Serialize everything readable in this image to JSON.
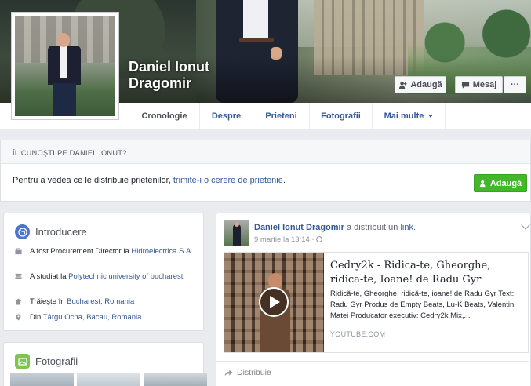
{
  "profile": {
    "name_line1": "Daniel Ionut",
    "name_line2": "Dragomir"
  },
  "cover_buttons": {
    "add_label": "Adaugă",
    "message_label": "Mesaj",
    "more_label": "···"
  },
  "nav": {
    "tabs": [
      {
        "label": "Cronologie",
        "active": true
      },
      {
        "label": "Despre"
      },
      {
        "label": "Prieteni"
      },
      {
        "label": "Fotografii"
      },
      {
        "label": "Mai multe"
      }
    ]
  },
  "friend_request": {
    "heading": "ÎL CUNOŞTI PE DANIEL IONUT?",
    "text_prefix": "Pentru a vedea ce le distribuie prietenilor, ",
    "text_link": "trimite-i o cerere de prietenie",
    "text_suffix": ".",
    "button_label": "Adaugă"
  },
  "intro": {
    "title": "Introducere",
    "items": [
      {
        "icon": "briefcase-icon",
        "prefix": "A fost Procurement Director la ",
        "link": "Hidroelectrica S.A."
      },
      {
        "icon": "graduation-cap-icon",
        "prefix": "A studiat la ",
        "link": "Polytechnic university of bucharest"
      },
      {
        "icon": "house-icon",
        "prefix": "Trăieşte în ",
        "link": "Bucharest, Romania"
      },
      {
        "icon": "location-pin-icon",
        "prefix": "Din ",
        "link": "Târgu Ocna, Bacau, Romania"
      }
    ]
  },
  "photos": {
    "title": "Fotografii"
  },
  "post": {
    "author": "Daniel Ionut Dragomir",
    "action": " a distribuit un ",
    "action_link": "link",
    "action_end": ".",
    "time": "9 martie la 13:14 · ",
    "share": {
      "title": "Cedry2k - Ridica-te, Gheorghe, ridica-te, Ioane! de Radu Gyr",
      "description": "Ridică-te, Gheorghe, ridică-te, ioane! de Radu Gyr Text: Radu Gyr Produs de Empty Beats, Lu-K Beats, Valentin Matei Producator executiv: Cedry2k Mix,...",
      "source": "YOUTUBE.COM"
    },
    "share_button": "Distribuie"
  },
  "colors": {
    "facebook_blue": "#365899",
    "green_button": "#42b72a",
    "background": "#e9ebee"
  }
}
